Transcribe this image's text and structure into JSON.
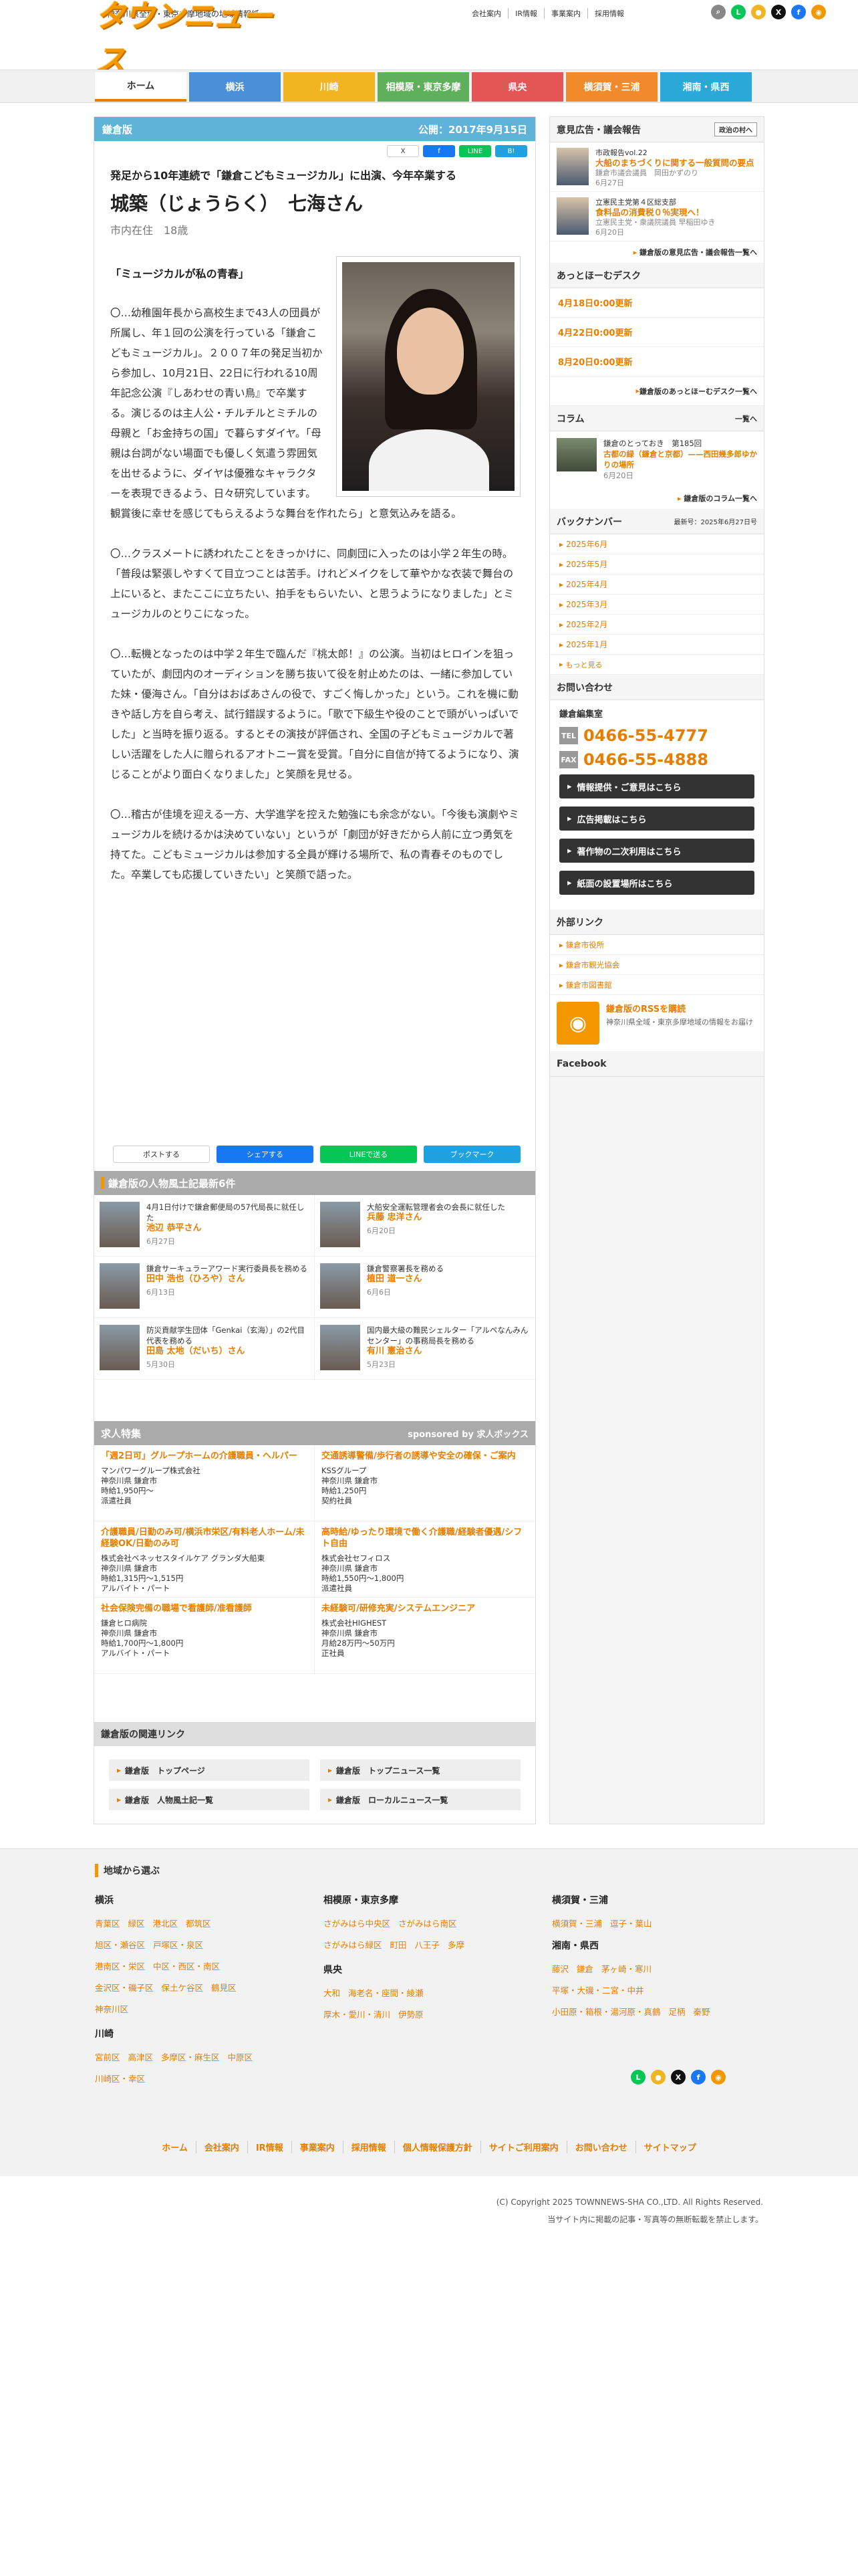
{
  "header": {
    "tagline": "神奈川県全域・東京多摩地域の地域情報紙",
    "logo_text": "タウンニュース",
    "links": [
      "会社案内",
      "IR情報",
      "事業案内",
      "採用情報"
    ]
  },
  "nav": {
    "tabs": [
      {
        "label": "ホーム",
        "color": "#ffffff"
      },
      {
        "label": "横浜",
        "color": "#4a90d9"
      },
      {
        "label": "川崎",
        "color": "#f0b521"
      },
      {
        "label": "相模原・東京多摩",
        "color": "#5fb05b"
      },
      {
        "label": "県央",
        "color": "#e25656"
      },
      {
        "label": "横須賀・三浦",
        "color": "#f08a2a"
      },
      {
        "label": "湘南・県西",
        "color": "#2aa8d8"
      }
    ]
  },
  "article": {
    "edition": "鎌倉版",
    "published": "公開：2017年9月15日",
    "share_small": [
      "X",
      "f",
      "LINE",
      "B!"
    ],
    "subtitle": "発足から10年連続で「鎌倉こどもミュージカル」に出演、今年卒業する",
    "name": "城築（じょうらく）　七海さん",
    "info": "市内在住　18歳",
    "heading": "「ミュージカルが私の青春」",
    "paragraphs": [
      "〇…幼稚園年長から高校生まで43人の団員が所属し、年１回の公演を行っている「鎌倉こどもミュージカル」。２００７年の発足当初から参加し、10月21日、22日に行われる10周年記念公演『しあわせの青い鳥』で卒業する。演じるのは主人公・チルチルとミチルの母親と「お金持ちの国」で暮らすダイヤ。「母親は台詞がない場面でも優しく気遣う雰囲気を出せるように、ダイヤは優雅なキャラクターを表現できるよう、日々研究しています。観賞後に幸せを感じてもらえるような舞台を作れたら」と意気込みを語る。",
      "〇…クラスメートに誘われたことをきっかけに、同劇団に入ったのは小学２年生の時。「普段は緊張しやすくて目立つことは苦手。けれどメイクをして華やかな衣装で舞台の上にいると、またここに立ちたい、拍手をもらいたい、と思うようになりました」とミュージカルのとりこになった。",
      "〇…転機となったのは中学２年生で臨んだ『桃太郎！』の公演。当初はヒロインを狙っていたが、劇団内のオーディションを勝ち抜いて役を射止めたのは、一緒に参加していた妹・優海さん。「自分はおばあさんの役で、すごく悔しかった」という。これを機に動きや話し方を自ら考え、試行錯誤するように。「歌で下級生や役のことで頭がいっぱいでした」と当時を振り返る。するとその演技が評価され、全国の子どもミュージカルで著しい活躍をした人に贈られるアオトニー賞を受賞。「自分に自信が持てるようになり、演じることがより面白くなりました」と笑顔を見せる。",
      "〇…稽古が佳境を迎える一方、大学進学を控えた勉強にも余念がない。「今後も演劇やミュージカルを続けるかは決めていない」というが「劇団が好きだから人前に立つ勇気を持てた。こどもミュージカルは参加する全員が輝ける場所で、私の青春そのものでした。卒業しても応援していきたい」と笑顔で語った。"
    ],
    "share_big": [
      {
        "label": "ポストする",
        "color": "#ffffff"
      },
      {
        "label": "シェアする",
        "color": "#1877f2"
      },
      {
        "label": "LINEで送る",
        "color": "#06c755"
      },
      {
        "label": "ブックマーク",
        "color": "#1fa2e0"
      }
    ]
  },
  "people": {
    "title": "鎌倉版の人物風土記最新6件",
    "items": [
      {
        "desc": "4月1日付けで鎌倉郵便局の57代局長に就任した",
        "name": "池辺 恭平さん",
        "date": "6月27日"
      },
      {
        "desc": "大船安全運転管理者会の会長に就任した",
        "name": "兵藤 忠洋さん",
        "date": "6月20日"
      },
      {
        "desc": "鎌倉サーキュラーアワード実行委員長を務める",
        "name": "田中 浩也（ひろや）さん",
        "date": "6月13日"
      },
      {
        "desc": "鎌倉警察署長を務める",
        "name": "植田 道一さん",
        "date": "6月6日"
      },
      {
        "desc": "防災貢献学生団体「Genkai（玄海）」の2代目代表を務める",
        "name": "田島 太地（だいち）さん",
        "date": "5月30日"
      },
      {
        "desc": "国内最大級の難民シェルター「アルペなんみんセンター」の事務局長を務める",
        "name": "有川 憲治さん",
        "date": "5月23日"
      }
    ]
  },
  "jobs": {
    "title": "求人特集",
    "sponsor": "sponsored by 求人ボックス",
    "items": [
      {
        "title": "「週2日可」グループホームの介護職員・ヘルパー",
        "company": "マンパワーグループ株式会社",
        "place": "神奈川県 鎌倉市",
        "pay": "時給1,950円～",
        "type": "派遣社員"
      },
      {
        "title": "交通誘導警備/歩行者の誘導や安全の確保・ご案内",
        "company": "KSSグループ",
        "place": "神奈川県 鎌倉市",
        "pay": "時給1,250円",
        "type": "契約社員"
      },
      {
        "title": "介護職員/日勤のみ可/横浜市栄区/有料老人ホーム/未経験OK/日勤のみ可",
        "company": "株式会社ベネッセスタイルケア グランダ大船東",
        "place": "神奈川県 鎌倉市",
        "pay": "時給1,315円～1,515円",
        "type": "アルバイト・パート"
      },
      {
        "title": "高時給/ゆったり環境で働く介護職/経験者優遇/シフト自由",
        "company": "株式会社セフィロス",
        "place": "神奈川県 鎌倉市",
        "pay": "時給1,550円～1,800円",
        "type": "派遣社員"
      },
      {
        "title": "社会保険完備の職場で看護師/准看護師",
        "company": "鎌倉ヒロ病院",
        "place": "神奈川県 鎌倉市",
        "pay": "時給1,700円～1,800円",
        "type": "アルバイト・パート"
      },
      {
        "title": "未経験可/研修充実/システムエンジニア",
        "company": "株式会社HIGHEST",
        "place": "神奈川県 鎌倉市",
        "pay": "月給28万円～50万円",
        "type": "正社員"
      }
    ]
  },
  "related": {
    "title": "鎌倉版の関連リンク",
    "links": [
      "鎌倉版　トップページ",
      "鎌倉版　トップニュース一覧",
      "鎌倉版　人物風土記一覧",
      "鎌倉版　ローカルニュース一覧"
    ]
  },
  "sidebar": {
    "ad_title": "意見広告・議会報告",
    "ad_button": "政治の村へ",
    "ads": [
      {
        "tag": "市政報告vol.22",
        "title": "大船のまちづくりに関する一般質問の要点",
        "author": "鎌倉市議会議員　岡田かずのり",
        "date": "6月27日"
      },
      {
        "tag": "立憲民主党第４区総支部",
        "title": "食料品の消費税０％実現へ！",
        "author": "立憲民主党・衆議院議員 早稲田ゆき",
        "date": "6月20日"
      }
    ],
    "ad_more": "鎌倉版の意見広告・議会報告一覧へ",
    "desk_title": "あっとほーむデスク",
    "desk_items": [
      "4月18日0:00更新",
      "4月22日0:00更新",
      "8月20日0:00更新"
    ],
    "desk_more": "鎌倉版のあっとほーむデスク一覧へ",
    "column_title": "コラム",
    "column_all": "一覧へ",
    "column_tag": "鎌倉のとっておき　第185回",
    "column_text": "古都の緑（鎌倉と京都）——西田幾多郎ゆかりの場所",
    "column_date": "6月20日",
    "column_more": "鎌倉版のコラム一覧へ",
    "back_title": "バックナンバー",
    "back_latest": "最新号：2025年6月27日号",
    "back_items": [
      "2025年6月",
      "2025年5月",
      "2025年4月",
      "2025年3月",
      "2025年2月",
      "2025年1月"
    ],
    "back_more": "もっと見る",
    "contact_title": "お問い合わせ",
    "contact_name": "鎌倉編集室",
    "tel_label": "TEL",
    "tel": "0466-55-4777",
    "fax_label": "FAX",
    "fax": "0466-55-4888",
    "buttons": [
      "情報提供・ご意見はこちら",
      "広告掲載はこちら",
      "著作物の二次利用はこちら",
      "紙面の設置場所はこちら"
    ],
    "ext_title": "外部リンク",
    "ext_links": [
      "鎌倉市役所",
      "鎌倉市観光協会",
      "鎌倉市図書館"
    ],
    "rss_title": "鎌倉版のRSSを購読",
    "rss_desc": "神奈川県全域・東京多摩地域の情報をお届け",
    "facebook": "Facebook"
  },
  "footer": {
    "title": "地域から選ぶ",
    "yokohama_title": "横浜",
    "yokohama": [
      "青葉区",
      "緑区",
      "港北区",
      "都筑区",
      "旭区・瀬谷区",
      "戸塚区・泉区",
      "港南区・栄区",
      "中区・西区・南区",
      "金沢区・磯子区",
      "保土ケ谷区",
      "鶴見区",
      "神奈川区"
    ],
    "kawasaki_title": "川崎",
    "kawasaki": [
      "宮前区",
      "高津区",
      "多摩区・麻生区",
      "中原区",
      "川崎区・幸区"
    ],
    "sagami_title": "相模原・東京多摩",
    "sagami": [
      "さがみはら中央区",
      "さがみはら南区",
      "さがみはら緑区",
      "町田",
      "八王子",
      "多摩"
    ],
    "kenou_title": "県央",
    "kenou": [
      "大和",
      "海老名・座間・綾瀬",
      "厚木・愛川・清川",
      "伊勢原"
    ],
    "yokosuka_title": "横須賀・三浦",
    "yokosuka": [
      "横須賀・三浦",
      "逗子・葉山"
    ],
    "shonan_title": "湘南・県西",
    "shonan": [
      "藤沢",
      "鎌倉",
      "茅ヶ崎・寒川",
      "平塚・大磯・二宮・中井",
      "小田原・箱根・湯河原・真鶴",
      "足柄",
      "秦野"
    ],
    "nav": [
      "ホーム",
      "会社案内",
      "IR情報",
      "事業案内",
      "採用情報",
      "個人情報保護方針",
      "サイトご利用案内",
      "お問い合わせ",
      "サイトマップ"
    ],
    "copyright": "(C) Copyright 2025 TOWNNEWS-SHA CO.,LTD. All Rights Reserved.",
    "notice": "当サイト内に掲載の記事・写真等の無断転載を禁止します。"
  }
}
